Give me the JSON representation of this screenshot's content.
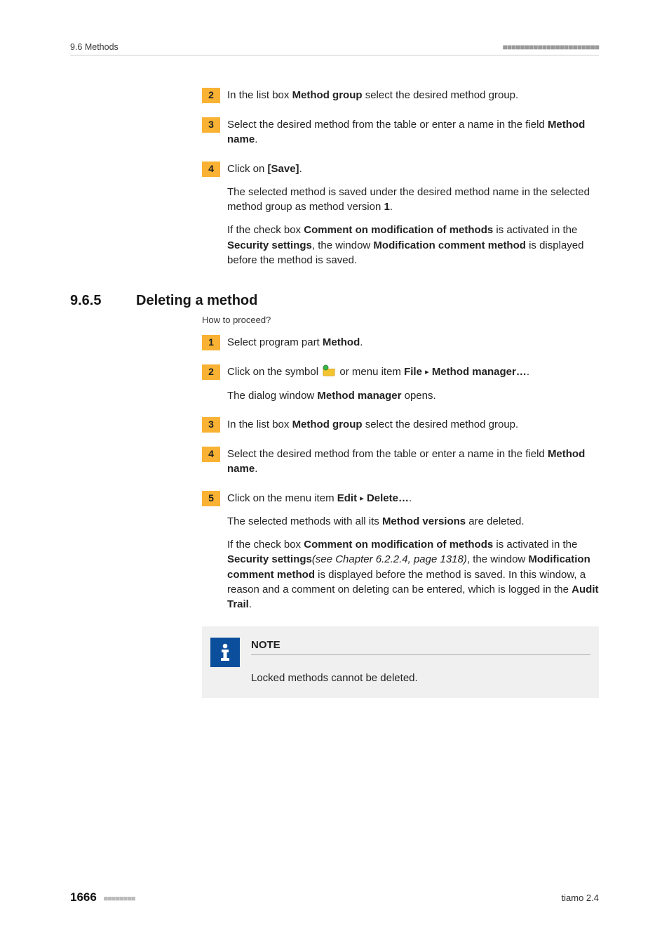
{
  "header": {
    "section": "9.6 Methods",
    "dashes": "■■■■■■■■■■■■■■■■■■■■■■"
  },
  "steps_a": [
    {
      "n": "2",
      "paras": [
        {
          "runs": [
            {
              "t": "In the list box "
            },
            {
              "t": "Method group",
              "b": true
            },
            {
              "t": " select the desired method group."
            }
          ]
        }
      ]
    },
    {
      "n": "3",
      "paras": [
        {
          "runs": [
            {
              "t": "Select the desired method from the table or enter a name in the field "
            },
            {
              "t": "Method name",
              "b": true
            },
            {
              "t": "."
            }
          ]
        }
      ]
    },
    {
      "n": "4",
      "paras": [
        {
          "runs": [
            {
              "t": "Click on "
            },
            {
              "t": "[Save]",
              "b": true
            },
            {
              "t": "."
            }
          ]
        },
        {
          "runs": [
            {
              "t": "The selected method is saved under the desired method name in the selected method group as method version "
            },
            {
              "t": "1",
              "b": true
            },
            {
              "t": "."
            }
          ]
        },
        {
          "runs": [
            {
              "t": "If the check box "
            },
            {
              "t": "Comment on modification of methods",
              "b": true
            },
            {
              "t": " is activated in the "
            },
            {
              "t": "Security settings",
              "b": true
            },
            {
              "t": ", the window "
            },
            {
              "t": "Modification comment method",
              "b": true
            },
            {
              "t": " is displayed before the method is saved."
            }
          ]
        }
      ]
    }
  ],
  "section": {
    "number": "9.6.5",
    "title": "Deleting a method",
    "howto": "How to proceed?"
  },
  "steps_b": [
    {
      "n": "1",
      "paras": [
        {
          "runs": [
            {
              "t": "Select program part "
            },
            {
              "t": "Method",
              "b": true
            },
            {
              "t": "."
            }
          ]
        }
      ]
    },
    {
      "n": "2",
      "paras": [
        {
          "runs": [
            {
              "t": "Click on the symbol "
            },
            {
              "icon": "method-manager-icon"
            },
            {
              "t": " or menu item "
            },
            {
              "t": "File",
              "b": true
            },
            {
              "t": " "
            },
            {
              "tri": true
            },
            {
              "t": " "
            },
            {
              "t": "Method manager…",
              "b": true
            },
            {
              "t": "."
            }
          ]
        },
        {
          "runs": [
            {
              "t": "The dialog window "
            },
            {
              "t": "Method manager",
              "b": true
            },
            {
              "t": " opens."
            }
          ]
        }
      ]
    },
    {
      "n": "3",
      "paras": [
        {
          "runs": [
            {
              "t": "In the list box "
            },
            {
              "t": "Method group",
              "b": true
            },
            {
              "t": " select the desired method group."
            }
          ]
        }
      ]
    },
    {
      "n": "4",
      "paras": [
        {
          "runs": [
            {
              "t": "Select the desired method from the table or enter a name in the field "
            },
            {
              "t": "Method name",
              "b": true
            },
            {
              "t": "."
            }
          ]
        }
      ]
    },
    {
      "n": "5",
      "paras": [
        {
          "runs": [
            {
              "t": "Click on the menu item "
            },
            {
              "t": "Edit",
              "b": true
            },
            {
              "t": " "
            },
            {
              "tri": true
            },
            {
              "t": " "
            },
            {
              "t": "Delete…",
              "b": true
            },
            {
              "t": "."
            }
          ]
        },
        {
          "runs": [
            {
              "t": "The selected methods with all its "
            },
            {
              "t": "Method versions",
              "b": true
            },
            {
              "t": " are deleted."
            }
          ]
        },
        {
          "runs": [
            {
              "t": "If the check box "
            },
            {
              "t": "Comment on modification of methods",
              "b": true
            },
            {
              "t": " is activated in the "
            },
            {
              "t": "Security settings",
              "b": true
            },
            {
              "t": "(see Chapter 6.2.2.4, page 1318)",
              "i": true
            },
            {
              "t": ", the window "
            },
            {
              "t": "Modification comment method",
              "b": true
            },
            {
              "t": " is displayed before the method is saved. In this window, a reason and a comment on deleting can be entered, which is logged in the "
            },
            {
              "t": "Audit Trail",
              "b": true
            },
            {
              "t": "."
            }
          ]
        }
      ]
    }
  ],
  "note": {
    "title": "NOTE",
    "body": "Locked methods cannot be deleted."
  },
  "footer": {
    "page": "1666",
    "dashes": "■■■■■■■■",
    "product": "tiamo 2.4"
  }
}
